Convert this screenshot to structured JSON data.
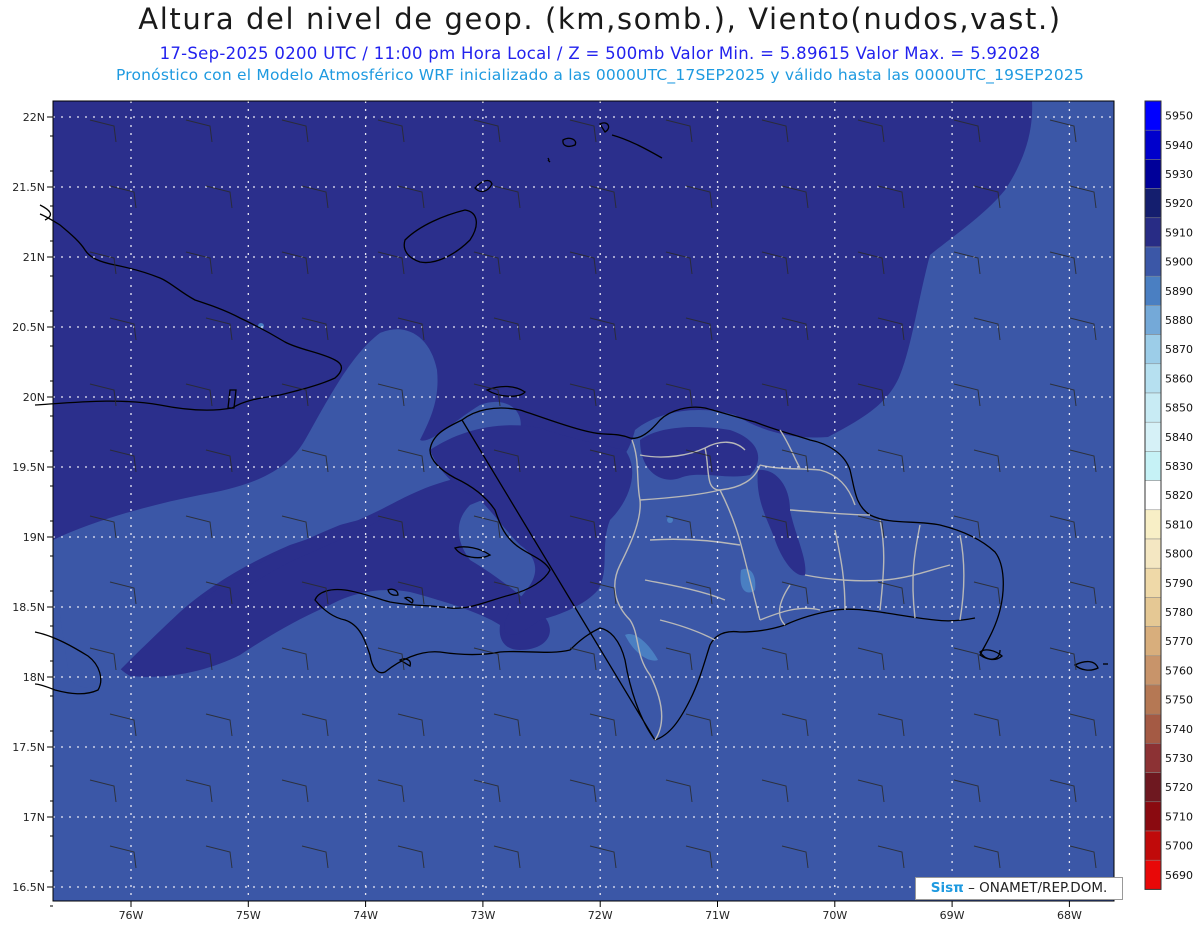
{
  "header": {
    "title": "Altura del nivel de geop. (km,somb.), Viento(nudos,vast.)",
    "subtitle1": "17-Sep-2025  0200 UTC / 11:00 pm Hora Local / Z = 500mb    Valor Min. = 5.89615   Valor Max. = 5.92028",
    "subtitle2": "Pronóstico con el Modelo Atmosférico WRF inicializado a las 0000UTC_17SEP2025 y válido hasta las  0000UTC_19SEP2025"
  },
  "map": {
    "lat_labels": [
      "22N",
      "21.5N",
      "21N",
      "20.5N",
      "20N",
      "19.5N",
      "19N",
      "18.5N",
      "18N",
      "17.5N",
      "17N",
      "16.5N"
    ],
    "lon_labels": [
      "76W",
      "75W",
      "74W",
      "73W",
      "72W",
      "71W",
      "70W",
      "69W",
      "68W"
    ],
    "colors": {
      "band_5900": "#3b57a7",
      "band_5910": "#2b2f8c",
      "band_5890": "#4a7fc2",
      "coast": "#000000",
      "provinces": "#b8b8b8",
      "gridline": "#e8e8f4",
      "wind_barb": "#2a2a2a"
    }
  },
  "legend": {
    "labels": [
      "5950",
      "5940",
      "5930",
      "5920",
      "5910",
      "5900",
      "5890",
      "5880",
      "5870",
      "5860",
      "5850",
      "5840",
      "5830",
      "5820",
      "5810",
      "5800",
      "5790",
      "5780",
      "5770",
      "5760",
      "5750",
      "5740",
      "5730",
      "5720",
      "5710",
      "5700",
      "5690"
    ],
    "colors": [
      "#0000ff",
      "#0000cc",
      "#000099",
      "#141e6e",
      "#282c85",
      "#3b57a7",
      "#4a7fc2",
      "#74a9d8",
      "#9ccde8",
      "#b6e0f0",
      "#c8ebf4",
      "#d6f1f7",
      "#c6f2f6",
      "#ffffff",
      "#f8efc6",
      "#f4e7c2",
      "#efd9a8",
      "#e5c894",
      "#d8ae7c",
      "#c8946a",
      "#b57854",
      "#a45a44",
      "#8c3234",
      "#6e1820",
      "#8a0a10",
      "#c00a0a",
      "#e80808"
    ]
  },
  "credit": {
    "brand": "Sisπ",
    "org": " – ONAMET/REP.DOM."
  }
}
